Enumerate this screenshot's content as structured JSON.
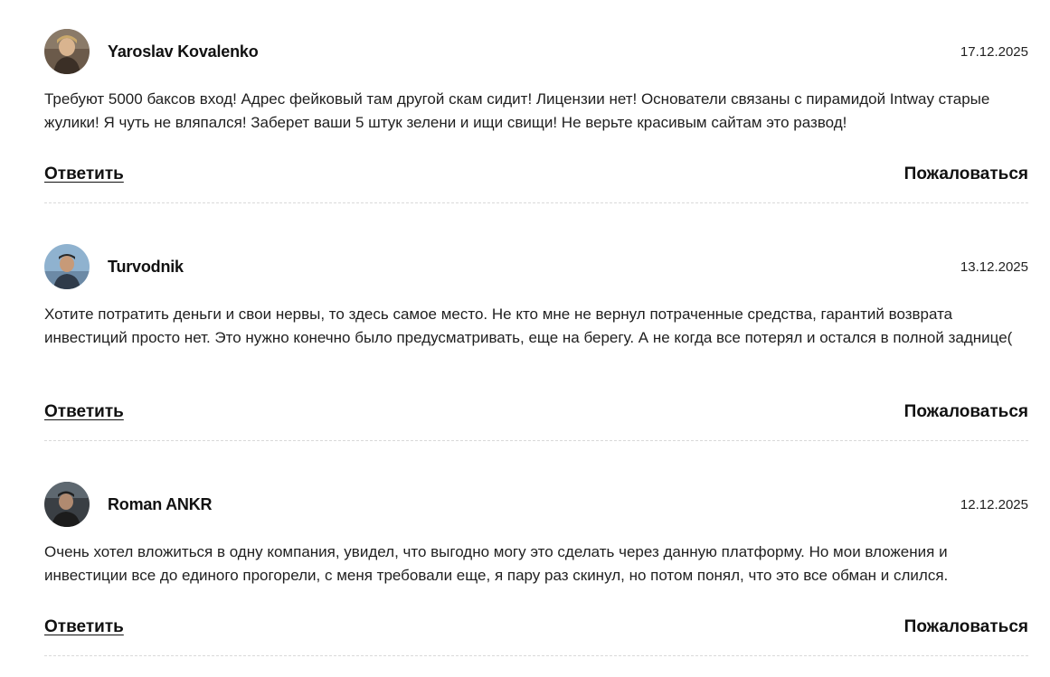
{
  "comments": [
    {
      "author": "Yaroslav Kovalenko",
      "date": "17.12.2025",
      "text": "Требуют 5000 баксов вход! Адрес фейковый там другой скам сидит! Лицензии нет! Основатели связаны с пирамидой Intway старые жулики! Я чуть не вляпался! Заберет ваши 5 штук зелени и ищи свищи! Не верьте красивым сайтам это развод!",
      "reply_label": "Ответить",
      "report_label": "Пожаловаться"
    },
    {
      "author": "Turvodnik",
      "date": "13.12.2025",
      "text": "Хотите потратить деньги и свои нервы, то здесь самое место. Не кто мне не вернул потраченные средства, гарантий возврата инвестиций просто нет. Это нужно конечно было предусматривать, еще на берегу. А не когда все потерял и остался в полной заднице(",
      "reply_label": "Ответить",
      "report_label": "Пожаловаться"
    },
    {
      "author": "Roman ANKR",
      "date": "12.12.2025",
      "text": "Очень хотел вложиться в одну компания, увидел, что выгодно могу это сделать через данную платформу. Но мои вложения и инвестиции все до единого прогорели, с меня требовали еще, я пару раз скинул, но потом понял, что это все обман и слился.",
      "reply_label": "Ответить",
      "report_label": "Пожаловаться"
    }
  ]
}
